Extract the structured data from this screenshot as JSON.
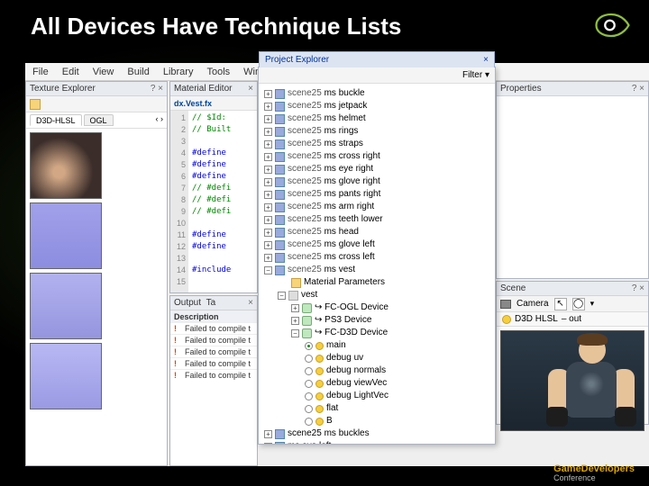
{
  "slide": {
    "title": "All Devices Have Technique Lists"
  },
  "menubar": [
    "File",
    "Edit",
    "View",
    "Build",
    "Library",
    "Tools",
    "Window"
  ],
  "texture_explorer": {
    "title": "Texture Explorer",
    "close_hint": "? ×",
    "tabs": [
      "D3D-HLSL",
      "OGL"
    ],
    "selected_index": 0
  },
  "editor": {
    "title": "Material Editor",
    "filename": "dx.Vest.fx",
    "lines": [
      {
        "n": "1",
        "t": "// $Id:",
        "cls": "kw-grn"
      },
      {
        "n": "2",
        "t": "// Built",
        "cls": "kw-grn"
      },
      {
        "n": "3",
        "t": "",
        "cls": ""
      },
      {
        "n": "4",
        "t": "#define",
        "cls": "kw-blue"
      },
      {
        "n": "5",
        "t": "#define",
        "cls": "kw-blue"
      },
      {
        "n": "6",
        "t": "#define",
        "cls": "kw-blue"
      },
      {
        "n": "7",
        "t": "// #defi",
        "cls": "kw-grn"
      },
      {
        "n": "8",
        "t": "// #defi",
        "cls": "kw-grn"
      },
      {
        "n": "9",
        "t": "// #defi",
        "cls": "kw-grn"
      },
      {
        "n": "10",
        "t": "",
        "cls": ""
      },
      {
        "n": "11",
        "t": "#define",
        "cls": "kw-blue"
      },
      {
        "n": "12",
        "t": "#define",
        "cls": "kw-blue"
      },
      {
        "n": "13",
        "t": "",
        "cls": ""
      },
      {
        "n": "14",
        "t": "#include",
        "cls": "kw-blue"
      },
      {
        "n": "15",
        "t": "",
        "cls": ""
      }
    ]
  },
  "output": {
    "title": "Output",
    "tab": "Ta",
    "header": "Description",
    "rows": [
      "Failed to compile t",
      "Failed to compile t",
      "Failed to compile t",
      "Failed to compile t",
      "Failed to compile t"
    ]
  },
  "explorer": {
    "title": "Project Explorer",
    "close": "×",
    "filter_label": "Filter ▾",
    "scene_items": [
      "ms buckle",
      "ms jetpack",
      "ms helmet",
      "ms rings",
      "ms straps",
      "ms cross right",
      "ms eye right",
      "ms glove right",
      "ms pants right",
      "ms arm right",
      "ms teeth lower",
      "ms head",
      "ms glove left",
      "ms cross left"
    ],
    "scene_pkg": "scene25",
    "vest_label": "ms vest",
    "vest_sub1": "Material Parameters",
    "vest_sub2": "vest",
    "devices": [
      "FC-OGL Device",
      "PS3 Device",
      "FC-D3D Device"
    ],
    "techniques": [
      {
        "name": "main",
        "on": true
      },
      {
        "name": "debug uv",
        "on": false
      },
      {
        "name": "debug normals",
        "on": false
      },
      {
        "name": "debug viewVec",
        "on": false
      },
      {
        "name": "debug LightVec",
        "on": false
      },
      {
        "name": "flat",
        "on": false
      },
      {
        "name": "B",
        "on": false
      }
    ],
    "trailing": [
      "scene25 ms buckles",
      "ms eye left"
    ]
  },
  "properties": {
    "title": "Properties",
    "close": "? ×"
  },
  "scene": {
    "title": "Scene",
    "close": "? ×",
    "camera_label": "Camera",
    "api_label": "D3D HLSL",
    "extra": "– out"
  },
  "footer": {
    "brand": "GameDevelopers",
    "sub": "Conference"
  }
}
